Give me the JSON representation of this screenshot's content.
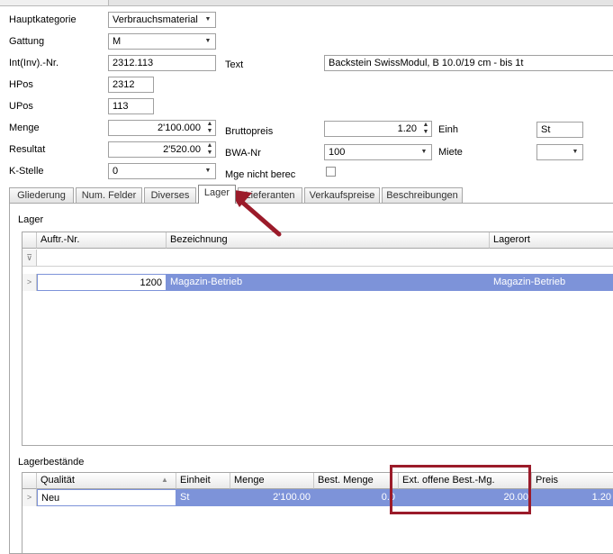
{
  "form": {
    "hauptkategorie_label": "Hauptkategorie",
    "hauptkategorie_value": "Verbrauchsmaterial",
    "gattung_label": "Gattung",
    "gattung_value": "M",
    "intnr_label": "Int(Inv).-Nr.",
    "intnr_value": "2312.113",
    "text_label": "Text",
    "text_value": "Backstein SwissModul, B 10.0/19 cm - bis 1t",
    "hpos_label": "HPos",
    "hpos_value": "2312",
    "upos_label": "UPos",
    "upos_value": "113",
    "menge_label": "Menge",
    "menge_value": "2'100.000",
    "bruttopreis_label": "Bruttopreis",
    "bruttopreis_value": "1.20",
    "einh_label": "Einh",
    "einh_value": "St",
    "resultat_label": "Resultat",
    "resultat_value": "2'520.00",
    "bwanr_label": "BWA-Nr",
    "bwanr_value": "100",
    "miete_label": "Miete",
    "miete_value": "",
    "kstelle_label": "K-Stelle",
    "kstelle_value": "0",
    "mge_label": "Mge nicht berec"
  },
  "tabs": [
    {
      "label": "Gliederung"
    },
    {
      "label": "Num. Felder"
    },
    {
      "label": "Diverses"
    },
    {
      "label": "Lager"
    },
    {
      "label": "Lieferanten"
    },
    {
      "label": "Verkaufspreise"
    },
    {
      "label": "Beschreibungen"
    }
  ],
  "active_tab": "Lager",
  "lager": {
    "title": "Lager",
    "columns": [
      "Auftr.-Nr.",
      "Bezeichnung",
      "Lagerort"
    ],
    "rows": [
      {
        "auftr": "1200",
        "bezeichnung": "Magazin-Betrieb",
        "lagerort": "Magazin-Betrieb"
      }
    ]
  },
  "bestaende": {
    "title": "Lagerbestände",
    "columns": [
      "Qualität",
      "Einheit",
      "Menge",
      "Best. Menge",
      "Ext. offene Best.-Mg.",
      "Preis"
    ],
    "rows": [
      {
        "qualitaet": "Neu",
        "einheit": "St",
        "menge": "2'100.00",
        "best_menge": "0.0",
        "ext_offene": "20.00",
        "preis": "1.20"
      }
    ]
  },
  "colors": {
    "selection": "#7d93d9",
    "annotation": "#9b1b2a"
  }
}
